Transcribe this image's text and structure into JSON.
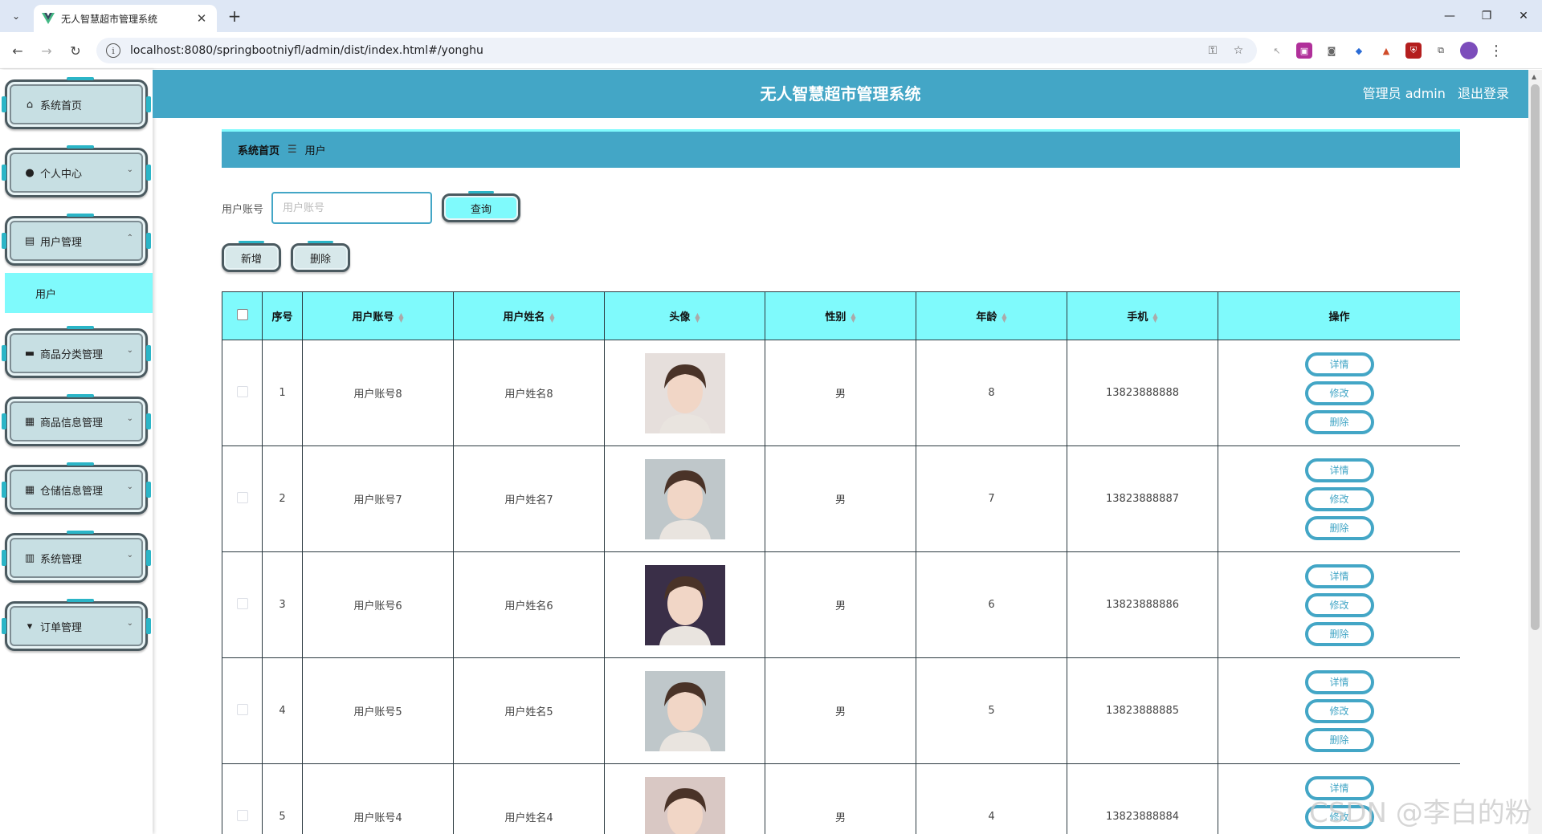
{
  "browser": {
    "tab_title": "无人智慧超市管理系统",
    "url": "localhost:8080/springbootniyfl/admin/dist/index.html#/yonghu"
  },
  "colors": {
    "accent": "#43a6c6",
    "highlight": "#7ffafc",
    "plate": "#c7dfe3"
  },
  "header": {
    "title": "无人智慧超市管理系统",
    "user": "管理员 admin",
    "logout": "退出登录"
  },
  "sidebar": {
    "items": [
      {
        "label": "系统首页",
        "icon": "home-icon"
      },
      {
        "label": "个人中心",
        "icon": "person-icon"
      },
      {
        "label": "用户管理",
        "icon": "briefcase-icon"
      },
      {
        "label": "商品分类管理",
        "icon": "chat-icon"
      },
      {
        "label": "商品信息管理",
        "icon": "grid-icon"
      },
      {
        "label": "仓储信息管理",
        "icon": "grid-icon"
      },
      {
        "label": "系统管理",
        "icon": "clipboard-icon"
      },
      {
        "label": "订单管理",
        "icon": "sign-icon"
      }
    ],
    "submenu": "用户"
  },
  "breadcrumb": {
    "home": "系统首页",
    "current": "用户"
  },
  "search": {
    "label": "用户账号",
    "placeholder": "用户账号",
    "button": "查询"
  },
  "actions": {
    "add": "新增",
    "delete": "删除"
  },
  "table": {
    "headers": [
      "序号",
      "用户账号",
      "用户姓名",
      "头像",
      "性别",
      "年龄",
      "手机",
      "操作"
    ],
    "rows": [
      {
        "index": "1",
        "account": "用户账号8",
        "name": "用户姓名8",
        "gender": "男",
        "age": "8",
        "phone": "13823888888",
        "avatar": "#e6dfdc"
      },
      {
        "index": "2",
        "account": "用户账号7",
        "name": "用户姓名7",
        "gender": "男",
        "age": "7",
        "phone": "13823888887",
        "avatar": "#bfc7ca"
      },
      {
        "index": "3",
        "account": "用户账号6",
        "name": "用户姓名6",
        "gender": "男",
        "age": "6",
        "phone": "13823888886",
        "avatar": "#3a2f48"
      },
      {
        "index": "4",
        "account": "用户账号5",
        "name": "用户姓名5",
        "gender": "男",
        "age": "5",
        "phone": "13823888885",
        "avatar": "#bfc7ca"
      },
      {
        "index": "5",
        "account": "用户账号4",
        "name": "用户姓名4",
        "gender": "男",
        "age": "4",
        "phone": "13823888884",
        "avatar": "#d9c8c4"
      }
    ],
    "ops": {
      "detail": "详情",
      "edit": "修改",
      "delete": "删除"
    }
  },
  "watermark": "CSDN @李白的粉"
}
